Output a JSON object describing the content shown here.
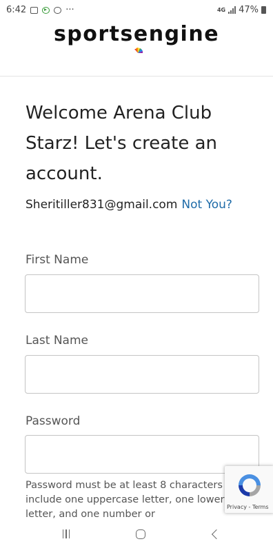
{
  "status_bar": {
    "time": "6:42",
    "ellipsis": "···",
    "network": "4G",
    "battery": "47%"
  },
  "header": {
    "logo_text": "sportsengine"
  },
  "main": {
    "welcome_title": "Welcome Arena Club Starz! Let's create an account.",
    "email": "Sheritiller831@gmail.com",
    "not_you": "Not You?",
    "fields": {
      "first_name_label": "First Name",
      "first_name_value": "",
      "last_name_label": "Last Name",
      "last_name_value": "",
      "password_label": "Password",
      "password_value": ""
    },
    "password_hint": "Password must be at least 8 characters and include one uppercase letter, one lowercase letter, and one number or"
  },
  "recaptcha": {
    "links": "Privacy - Terms"
  },
  "colors": {
    "link": "#1e6ba8",
    "input_border": "#c4c4c4"
  },
  "nav_icons": [
    "recent-apps-icon",
    "home-icon",
    "back-icon"
  ]
}
